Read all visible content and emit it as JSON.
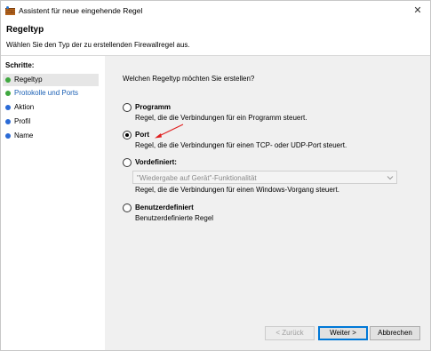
{
  "window": {
    "title": "Assistent für neue eingehende Regel",
    "close_glyph": "✕"
  },
  "header": {
    "title": "Regeltyp",
    "subtitle": "Wählen Sie den Typ der zu erstellenden Firewallregel aus."
  },
  "sidebar": {
    "heading": "Schritte:",
    "items": [
      {
        "label": "Regeltyp",
        "active": true,
        "dot_color": "#3fa83f"
      },
      {
        "label": "Protokolle und Ports",
        "active": false,
        "dot_color": "#3fa83f"
      },
      {
        "label": "Aktion",
        "active": false,
        "dot_color": "#2b6bd6"
      },
      {
        "label": "Profil",
        "active": false,
        "dot_color": "#2b6bd6"
      },
      {
        "label": "Name",
        "active": false,
        "dot_color": "#2b6bd6"
      }
    ]
  },
  "main": {
    "question": "Welchen Regeltyp möchten Sie erstellen?",
    "options": [
      {
        "title": "Programm",
        "desc": "Regel, die die Verbindungen für ein Programm steuert.",
        "checked": false
      },
      {
        "title": "Port",
        "desc": "Regel, die die Verbindungen für einen TCP- oder UDP-Port steuert.",
        "checked": true
      },
      {
        "title": "Vordefiniert:",
        "desc": "Regel, die die Verbindungen für einen Windows-Vorgang steuert.",
        "checked": false
      },
      {
        "title": "Benutzerdefiniert",
        "desc": "Benutzerdefinierte Regel",
        "checked": false
      }
    ],
    "predefined_dropdown": {
      "selected": "\"Wiedergabe auf Gerät\"-Funktionalität",
      "enabled": false
    },
    "annotation_arrow_color": "#e02020"
  },
  "footer": {
    "back_label": "< Zurück",
    "next_label": "Weiter >",
    "cancel_label": "Abbrechen"
  }
}
